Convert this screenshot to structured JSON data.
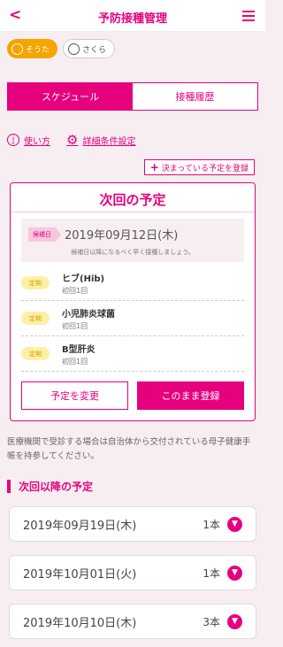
{
  "header": {
    "back": "<",
    "title": "予防接種管理"
  },
  "kids": [
    {
      "name": "そうた"
    },
    {
      "name": "さくら"
    }
  ],
  "tabs": [
    {
      "label": "スケジュール"
    },
    {
      "label": "接種履歴"
    }
  ],
  "links": {
    "howto": "使い方",
    "settings": "詳細条件設定"
  },
  "register_link": "決まっている予定を登録",
  "next": {
    "title": "次回の予定",
    "tag": "候補日",
    "date": "2019年09月12日(木)",
    "note": "候補日以降になるべく早く接種しましょう。",
    "vaccines": [
      {
        "badge": "定期",
        "name": "ヒブ(Hib)",
        "dose": "初回1回"
      },
      {
        "badge": "定期",
        "name": "小児肺炎球菌",
        "dose": "初回1回"
      },
      {
        "badge": "定期",
        "name": "B型肝炎",
        "dose": "初回1回"
      }
    ],
    "change_btn": "予定を変更",
    "register_btn": "このまま登録"
  },
  "notice": "医療機関で受診する場合は自治体から交付されている母子健康手帳を持参してください。",
  "future_title": "次回以降の予定",
  "future": [
    {
      "date": "2019年09月19日(木)",
      "count": "1本"
    },
    {
      "date": "2019年10月01日(火)",
      "count": "1本"
    },
    {
      "date": "2019年10月10日(木)",
      "count": "3本"
    }
  ]
}
